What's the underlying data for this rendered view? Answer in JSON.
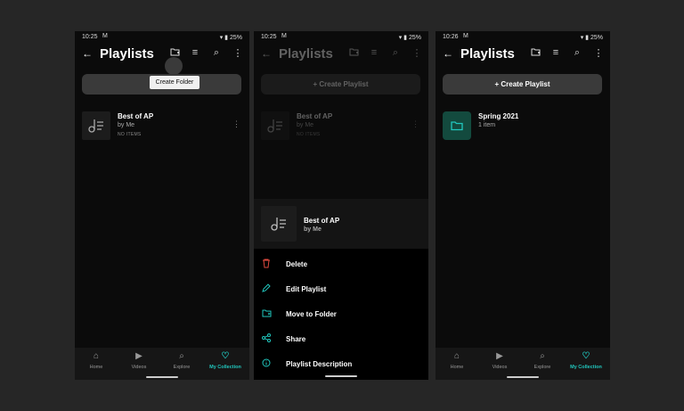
{
  "accent": "#21c7be",
  "delete_color": "#e04a3f",
  "screens": [
    {
      "status": {
        "time": "10:25",
        "mail": "M",
        "battery": "25%"
      }
    },
    {
      "status": {
        "time": "10:25",
        "mail": "M",
        "battery": "25%"
      }
    },
    {
      "status": {
        "time": "10:26",
        "mail": "M",
        "battery": "25%"
      }
    }
  ],
  "header": {
    "title": "Playlists",
    "back": "←",
    "more": "⋮"
  },
  "tooltip": "Create Folder",
  "create_button_partial": "+ C",
  "create_button": "+ Create Playlist",
  "playlist": {
    "name": "Best of AP",
    "owner": "by Me",
    "items": "NO ITEMS"
  },
  "folder": {
    "name": "Spring 2021",
    "count": "1 item"
  },
  "sheet": {
    "menu": [
      {
        "label": "Delete",
        "icon": "trash-icon"
      },
      {
        "label": "Edit Playlist",
        "icon": "pencil-icon"
      },
      {
        "label": "Move to Folder",
        "icon": "folder-move-icon"
      },
      {
        "label": "Share",
        "icon": "share-icon"
      },
      {
        "label": "Playlist Description",
        "icon": "info-icon"
      }
    ]
  },
  "nav": [
    {
      "label": "Home",
      "icon": "home-icon"
    },
    {
      "label": "Videos",
      "icon": "video-icon"
    },
    {
      "label": "Explore",
      "icon": "search-icon"
    },
    {
      "label": "My Collection",
      "icon": "heart-icon"
    }
  ]
}
